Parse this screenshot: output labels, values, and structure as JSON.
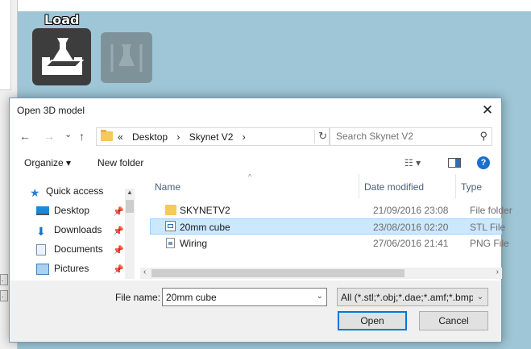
{
  "app": {
    "load_label": "Load"
  },
  "dialog": {
    "title": "Open 3D model",
    "close_glyph": "✕",
    "nav": {
      "back": "←",
      "forward": "→",
      "recent": "⌄",
      "up": "↑"
    },
    "breadcrumb": [
      "«",
      "Desktop",
      "›",
      "Skynet V2",
      "›"
    ],
    "refresh_glyph": "↻",
    "search_placeholder": "Search Skynet V2",
    "toolbar": {
      "organize": "Organize ▾",
      "new_folder": "New folder",
      "view_glyph": "☷ ▾",
      "help": "?"
    },
    "sidebar": [
      {
        "label": "Quick access",
        "icon": "star-icon",
        "pinned": false
      },
      {
        "label": "Desktop",
        "icon": "desktop-icon",
        "pinned": true
      },
      {
        "label": "Downloads",
        "icon": "download-icon",
        "pinned": true
      },
      {
        "label": "Documents",
        "icon": "documents-icon",
        "pinned": true
      },
      {
        "label": "Pictures",
        "icon": "pictures-icon",
        "pinned": true
      }
    ],
    "columns": {
      "name": "Name",
      "date": "Date modified",
      "type": "Type"
    },
    "files": [
      {
        "name": "SKYNETV2",
        "date": "21/09/2016 23:08",
        "type": "File folder",
        "icon": "folder-icon",
        "selected": false
      },
      {
        "name": "20mm cube",
        "date": "23/08/2016 02:20",
        "type": "STL File",
        "icon": "stl-file-icon",
        "selected": true
      },
      {
        "name": "Wiring",
        "date": "27/06/2016 21:41",
        "type": "PNG File",
        "icon": "image-file-icon",
        "selected": false
      }
    ],
    "filename_label": "File name:",
    "filename_value": "20mm cube",
    "filter_value": "All (*.stl;*.obj;*.dae;*.amf;*.bmp",
    "open_label": "Open",
    "cancel_label": "Cancel"
  },
  "colors": {
    "accent": "#0078d7",
    "selection": "#cce8ff",
    "background": "#9ec6d6"
  }
}
